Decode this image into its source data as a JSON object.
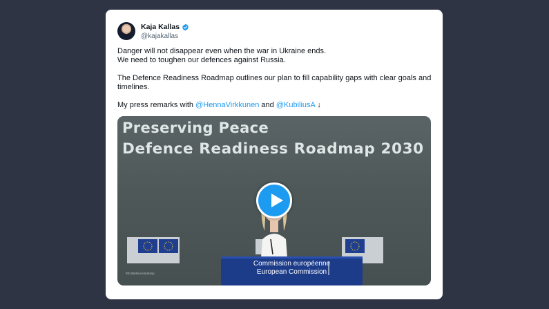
{
  "tweet": {
    "author_name": "Kaja Kallas",
    "handle": "@kajakallas",
    "lines": {
      "l1": "Danger will not disappear even when the war in Ukraine ends.",
      "l2": "We need to toughen our defences against Russia.",
      "l3": "The Defence Readiness Roadmap outlines our plan to fill capability gaps with clear goals and timelines.",
      "l4_prefix": "My press remarks with ",
      "mention1": "@HennaVirkkunen",
      "l4_mid": " and ",
      "mention2": "@KubiliusA",
      "l4_suffix": " ↓"
    }
  },
  "media": {
    "slide_title_line1": "Preserving Peace",
    "slide_title_line2": "Defence Readiness Roadmap 2030",
    "podium_line1": "Commission européenne",
    "podium_line2": "European Commission",
    "hashtag": "#EUDefenceIndustry"
  },
  "colors": {
    "background": "#2e3444",
    "accent": "#1d9bf0"
  }
}
